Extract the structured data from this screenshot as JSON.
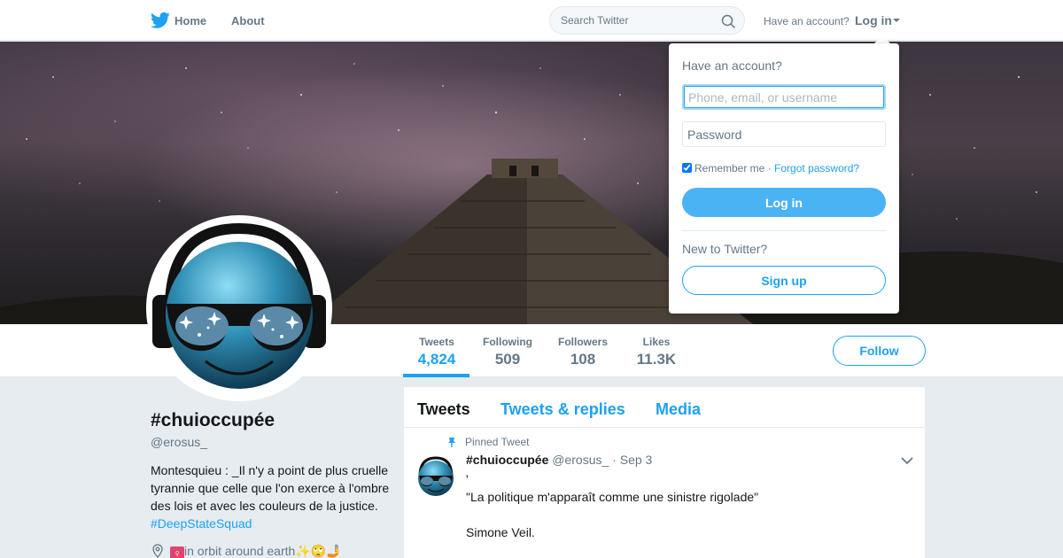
{
  "nav": {
    "logo_icon": "twitter-bird-icon",
    "home_label": "Home",
    "about_label": "About",
    "search_placeholder": "Search Twitter",
    "search_icon": "search-icon",
    "have_account": "Have an account?",
    "login_label": "Log in",
    "brand_color": "#1da1f2"
  },
  "profile": {
    "display_name": "#chuioccupée",
    "handle": "@erosus_",
    "bio_text": "Montesquieu : _Il n'y a point de plus cruelle tyrannie que celle que l'on exerce à l'ombre des lois et avec les couleurs de la justice. ",
    "bio_hashtag": "#DeepStateSquad",
    "location_text": "in orbit around earth✨🙄🤳",
    "location_symbol": "♀"
  },
  "stats": [
    {
      "label": "Tweets",
      "value": "4,824"
    },
    {
      "label": "Following",
      "value": "509"
    },
    {
      "label": "Followers",
      "value": "108"
    },
    {
      "label": "Likes",
      "value": "11.3K"
    }
  ],
  "follow_label": "Follow",
  "timeline": {
    "tabs": [
      "Tweets",
      "Tweets & replies",
      "Media"
    ],
    "pinned_label": "Pinned Tweet",
    "tweet": {
      "name": "#chuioccupée",
      "handle": "@erosus_",
      "date": "· Sep 3",
      "text": "'\n\"La politique m'apparaît comme une sinistre rigolade\"\n\nSimone Veil."
    }
  },
  "login_dropdown": {
    "title": "Have an account?",
    "username_placeholder": "Phone, email, or username",
    "password_placeholder": "Password",
    "remember_label": "Remember me",
    "separator": "·",
    "forgot_label": "Forgot password?",
    "login_button": "Log in",
    "new_label": "New to Twitter?",
    "signup_button": "Sign up"
  }
}
